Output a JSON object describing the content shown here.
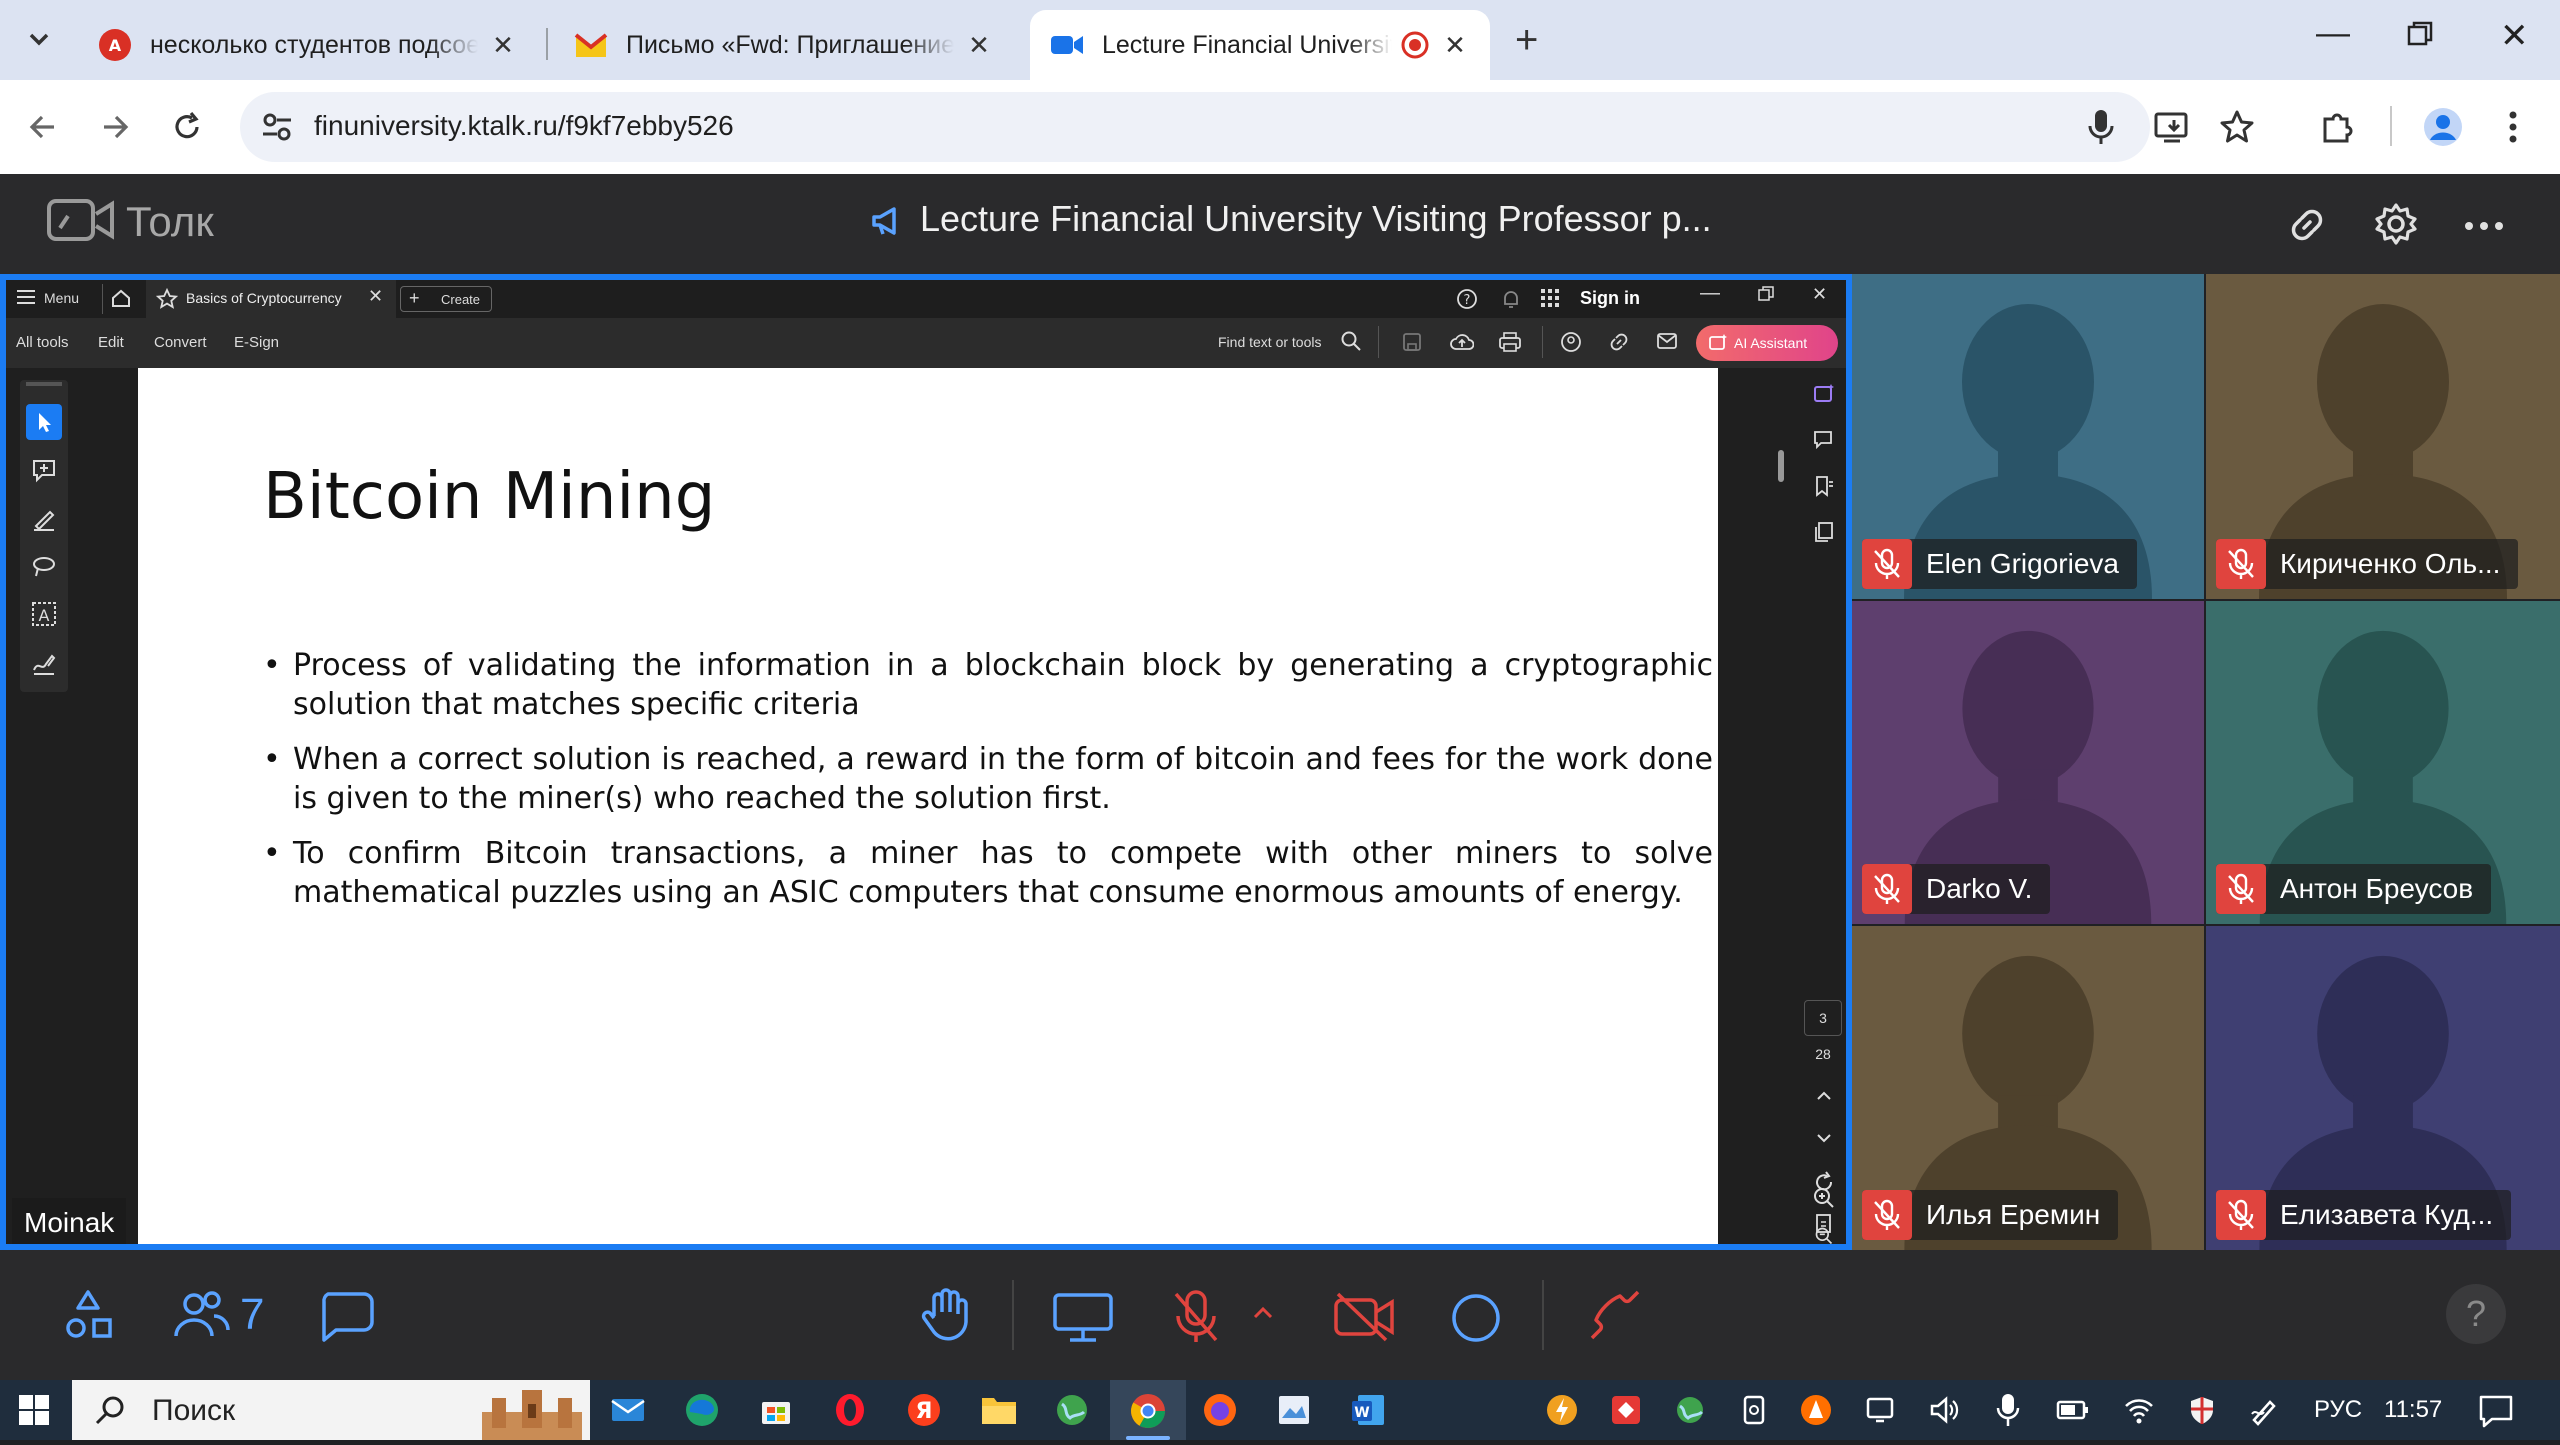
{
  "browser": {
    "tabs": [
      {
        "title": "несколько студентов подсоед",
        "favicon": "translate-icon"
      },
      {
        "title": "Письмо «Fwd: Приглашение н",
        "favicon": "mail-icon"
      },
      {
        "title": "Lecture Financial University",
        "favicon": "video-icon",
        "recording": true
      }
    ],
    "address": "finuniversity.ktalk.ru/f9kf7ebby526"
  },
  "app": {
    "brand": "Толк",
    "meeting_title": "Lecture Financial University Visiting Professor p..."
  },
  "pdf_viewer": {
    "menu_label": "Menu",
    "doc_tab": "Basics of Cryptocurrency",
    "create_label": "Create",
    "sign_in": "Sign in",
    "menus": [
      "All tools",
      "Edit",
      "Convert",
      "E-Sign"
    ],
    "find_placeholder": "Find text or tools",
    "ai_button": "AI Assistant",
    "page_current": "3",
    "page_total": "28",
    "presenter": "Moinak"
  },
  "slide": {
    "title": "Bitcoin Mining",
    "bullets": [
      "Process of validating the information in a blockchain block by generating a cryptographic solution that matches specific criteria",
      "When a correct solution is reached, a reward in the form of bitcoin and fees for the work done is given to the miner(s) who reached the solution first.",
      "To confirm Bitcoin transactions, a miner has to compete with other miners to solve mathematical puzzles using an ASIC computers that consume enormous amounts of energy."
    ]
  },
  "participants": [
    {
      "name": "Elen Grigorieva",
      "bg": "#3e6e85",
      "fig": "#2a5468"
    },
    {
      "name": "Кириченко Оль...",
      "bg": "#6a5a40",
      "fig": "#4e412c"
    },
    {
      "name": "Darko V.",
      "bg": "#5e3f6e",
      "fig": "#472e55"
    },
    {
      "name": "Антон Бреусов",
      "bg": "#3a6e6b",
      "fig": "#285451"
    },
    {
      "name": "Илья Еремин",
      "bg": "#6a5a40",
      "fig": "#4e412c"
    },
    {
      "name": "Елизавета Куд...",
      "bg": "#3f3f72",
      "fig": "#2e2e57"
    }
  ],
  "controls": {
    "participants_count": "7",
    "help": "?"
  },
  "taskbar": {
    "search_placeholder": "Поиск",
    "lang": "РУС",
    "time": "11:57"
  }
}
